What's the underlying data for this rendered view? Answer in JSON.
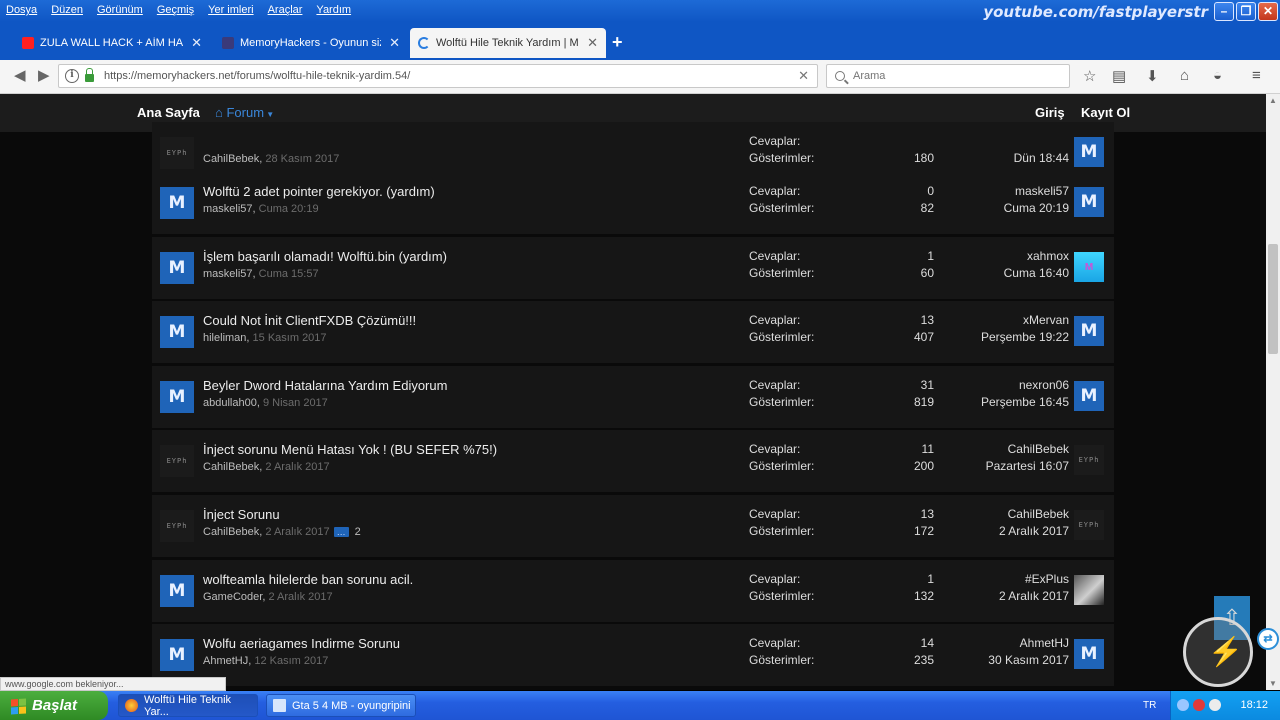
{
  "menubar": {
    "items": [
      "Dosya",
      "Düzen",
      "Görünüm",
      "Geçmiş",
      "Yer imleri",
      "Araçlar",
      "Yardım"
    ],
    "watermark": "youtube.com/fastplayerstr"
  },
  "tabs": [
    {
      "label": "ZULA WALL HACK + AİM HACK ...",
      "icon_color": "#ff2020"
    },
    {
      "label": "MemoryHackers - Oyunun sizinle...",
      "icon_color": "#3a3a7a"
    },
    {
      "label": "Wolftü Hile Teknik Yardım | Me...",
      "icon_color": "#2a7de0"
    }
  ],
  "navbar": {
    "url": "https://memoryhackers.net/forums/wolftu-hile-teknik-yardim.54/",
    "search_placeholder": "Arama"
  },
  "sitenav": {
    "home": "Ana Sayfa",
    "forum": "Forum",
    "login": "Giriş",
    "register": "Kayıt Ol"
  },
  "labels": {
    "replies": "Cevaplar:",
    "views": "Gösterimler:"
  },
  "threads": [
    {
      "title": "",
      "author": "CahilBebek",
      "date": "28 Kasım 2017",
      "replies": "",
      "views": "180",
      "last_user": "",
      "last_date": "Dün 18:44",
      "avatar": "eyph",
      "last_avatar": "m"
    },
    {
      "title": "Wolftü 2 adet pointer gerekiyor. (yardım)",
      "author": "maskeli57",
      "date": "Cuma 20:19",
      "replies": "0",
      "views": "82",
      "last_user": "maskeli57",
      "last_date": "Cuma 20:19",
      "avatar": "m",
      "last_avatar": "m"
    },
    {
      "title": "İşlem başarılı olamadı! Wolftü.bin (yardım)",
      "author": "maskeli57",
      "date": "Cuma 15:57",
      "replies": "1",
      "views": "60",
      "last_user": "xahmox",
      "last_date": "Cuma 16:40",
      "avatar": "m",
      "last_avatar": "x"
    },
    {
      "title": "Could Not İnit ClientFXDB Çözümü!!!",
      "author": "hileliman",
      "date": "15 Kasım 2017",
      "replies": "13",
      "views": "407",
      "last_user": "xMervan",
      "last_date": "Perşembe 19:22",
      "avatar": "m",
      "last_avatar": "m"
    },
    {
      "title": "Beyler Dword Hatalarına Yardım Ediyorum",
      "author": "abdullah00",
      "date": "9 Nisan 2017",
      "replies": "31",
      "views": "819",
      "last_user": "nexron06",
      "last_date": "Perşembe 16:45",
      "avatar": "m",
      "last_avatar": "m"
    },
    {
      "title": "İnject sorunu Menü Hatası Yok ! (BU SEFER %75!)",
      "author": "CahilBebek",
      "date": "2 Aralık 2017",
      "replies": "11",
      "views": "200",
      "last_user": "CahilBebek",
      "last_date": "Pazartesi 16:07",
      "avatar": "eyph",
      "last_avatar": "eyph"
    },
    {
      "title": "İnject Sorunu",
      "author": "CahilBebek",
      "date": "2 Aralık 2017",
      "replies": "13",
      "views": "172",
      "last_user": "CahilBebek",
      "last_date": "2 Aralık 2017",
      "avatar": "eyph",
      "last_avatar": "eyph",
      "page_link": "2"
    },
    {
      "title": "wolfteamla hilelerde ban sorunu acil.",
      "author": "GameCoder",
      "date": "2 Aralık 2017",
      "replies": "1",
      "views": "132",
      "last_user": "#ExPlus",
      "last_date": "2 Aralık 2017",
      "avatar": "m",
      "last_avatar": "photo"
    },
    {
      "title": "Wolfu aeriagames Indirme Sorunu",
      "author": "AhmetHJ",
      "date": "12 Kasım 2017",
      "replies": "14",
      "views": "235",
      "last_user": "AhmetHJ",
      "last_date": "30 Kasım 2017",
      "avatar": "m",
      "last_avatar": "m"
    }
  ],
  "statusbar": "www.google.com bekleniyor...",
  "taskbar": {
    "start": "Başlat",
    "items": [
      "Wolftü Hile Teknik Yar...",
      "Gta 5 4 MB - oyungripini"
    ],
    "lang": "TR",
    "time": "18:12"
  }
}
